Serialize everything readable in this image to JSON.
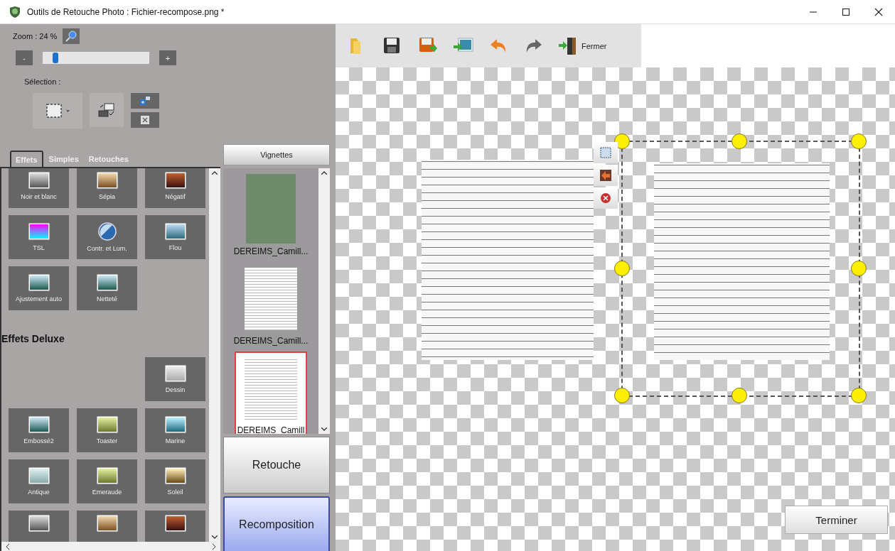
{
  "window": {
    "title": "Outils de Retouche Photo : Fichier-recompose.png *"
  },
  "zoom": {
    "label": "Zoom : 24 %",
    "minus": "-",
    "plus": "+",
    "level": 0.1
  },
  "selection": {
    "label": "Sélection :"
  },
  "tabs": [
    {
      "label": "Effets",
      "selected": true
    },
    {
      "label": "Simples",
      "selected": false
    },
    {
      "label": "Retouches",
      "selected": false
    }
  ],
  "effects": [
    {
      "label": "Noir et blanc"
    },
    {
      "label": "Sépia"
    },
    {
      "label": "Négatif"
    },
    {
      "label": "TSL"
    },
    {
      "label": "Contr. et Lum."
    },
    {
      "label": "Flou"
    },
    {
      "label": "Ajustement auto"
    },
    {
      "label": "Netteté"
    }
  ],
  "deluxe_heading": "Effets Deluxe",
  "deluxe_effects": [
    {
      "label": "Dessin"
    },
    {
      "label": "Embossé2"
    },
    {
      "label": "Toaster"
    },
    {
      "label": "Marine"
    },
    {
      "label": "Antique"
    },
    {
      "label": "Emeraude"
    },
    {
      "label": "Soleil"
    }
  ],
  "thumbnails": {
    "header": "Vignettes",
    "items": [
      {
        "label": "DEREIMS_Camill...",
        "kind": "photo",
        "selected": false
      },
      {
        "label": "DEREIMS_Camill...",
        "kind": "document",
        "selected": false
      },
      {
        "label": "DEREIMS_Camill",
        "kind": "document",
        "selected": true
      }
    ]
  },
  "modes": [
    {
      "label": "Retouche",
      "selected": false
    },
    {
      "label": "Recomposition",
      "selected": true
    }
  ],
  "toolbar": [
    {
      "kind": "open"
    },
    {
      "kind": "save"
    },
    {
      "kind": "save_as"
    },
    {
      "kind": "export"
    },
    {
      "kind": "undo"
    },
    {
      "kind": "redo"
    },
    {
      "kind": "close",
      "label": "Fermer"
    }
  ],
  "finish_button": "Terminer"
}
